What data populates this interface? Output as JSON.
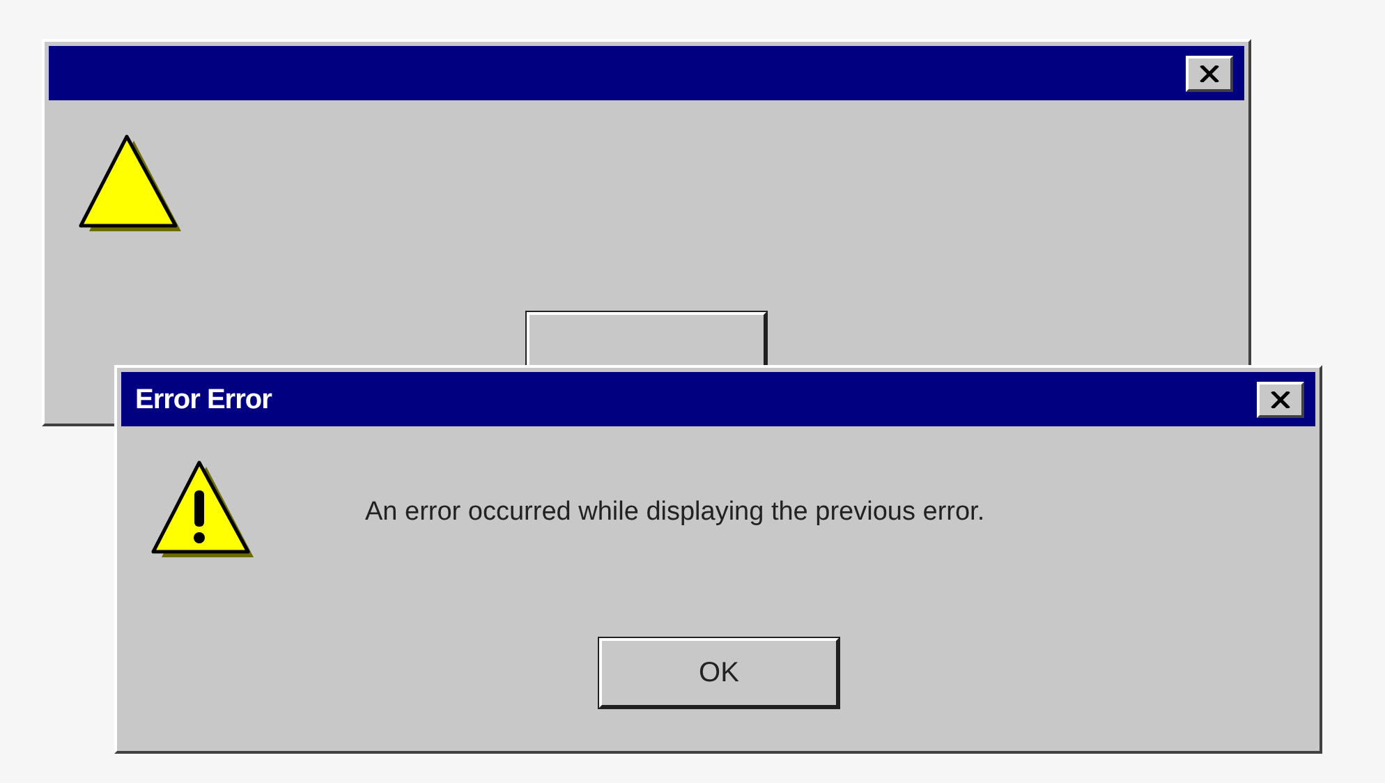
{
  "windows": [
    {
      "kind": "blank"
    },
    {
      "kind": "error",
      "title": "Error Error",
      "message": "An error occurred while displaying the previous error.",
      "button": "OK"
    }
  ]
}
